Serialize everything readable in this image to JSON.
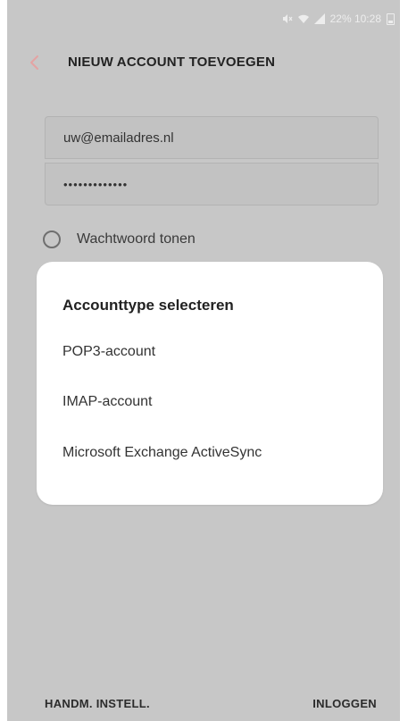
{
  "status_bar": {
    "text": "22% 10:28"
  },
  "header": {
    "title": "NIEUW ACCOUNT TOEVOEGEN",
    "back_icon": "chevron-left-icon"
  },
  "form": {
    "email_value": "uw@emailadres.nl",
    "password_value": "•••••••••••••",
    "show_password_label": "Wachtwoord tonen",
    "show_password_checked": false
  },
  "dialog": {
    "title": "Accounttype selecteren",
    "options": [
      "POP3-account",
      "IMAP-account",
      "Microsoft Exchange ActiveSync"
    ]
  },
  "bottom_bar": {
    "manual_label": "HANDM. INSTELL.",
    "login_label": "INLOGGEN"
  },
  "colors": {
    "accent_back": "#e4a3a3",
    "dim_background": "#c7c7c7",
    "dialog_background": "#ffffff"
  }
}
